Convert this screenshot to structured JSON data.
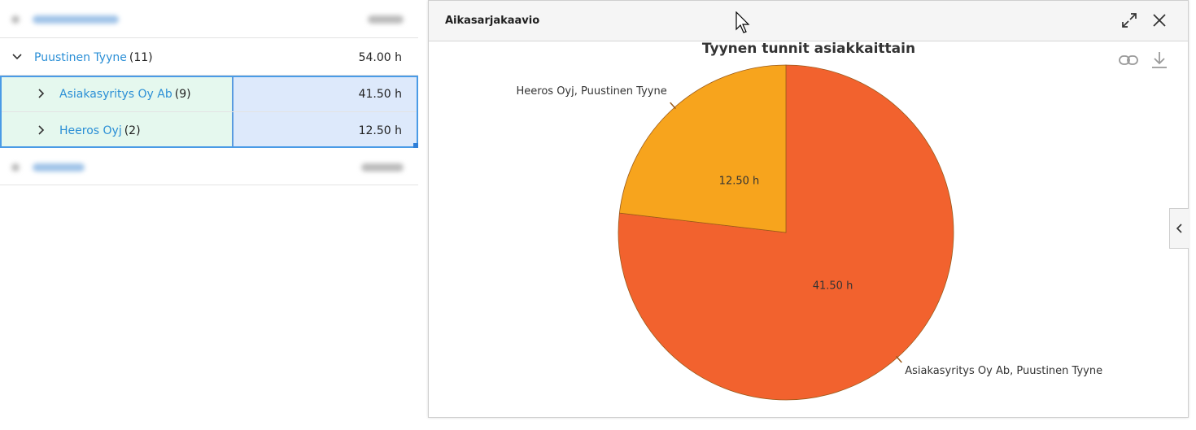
{
  "tree": {
    "parent": {
      "name": "Puustinen Tyyne",
      "count": "(11)",
      "value": "54.00 h"
    },
    "children": [
      {
        "name": "Asiakasyritys Oy Ab",
        "count": "(9)",
        "value": "41.50 h"
      },
      {
        "name": "Heeros Oyj",
        "count": "(2)",
        "value": "12.50 h"
      }
    ]
  },
  "panel": {
    "title": "Aikasarjakaavio",
    "icons": {
      "expand": "expand-icon",
      "close": "close-icon",
      "link": "link-icon",
      "download": "download-icon",
      "side": "chevron-left-icon"
    }
  },
  "chart_data": {
    "type": "pie",
    "title": "Tyynen tunnit asiakkaittain",
    "unit": "h",
    "slices": [
      {
        "label": "Asiakasyritys Oy Ab, Puustinen Tyyne",
        "value": 41.5,
        "value_label": "41.50 h",
        "color": "#f2622e"
      },
      {
        "label": "Heeros Oyj, Puustinen Tyyne",
        "value": 12.5,
        "value_label": "12.50 h",
        "color": "#f7a41d"
      }
    ]
  }
}
